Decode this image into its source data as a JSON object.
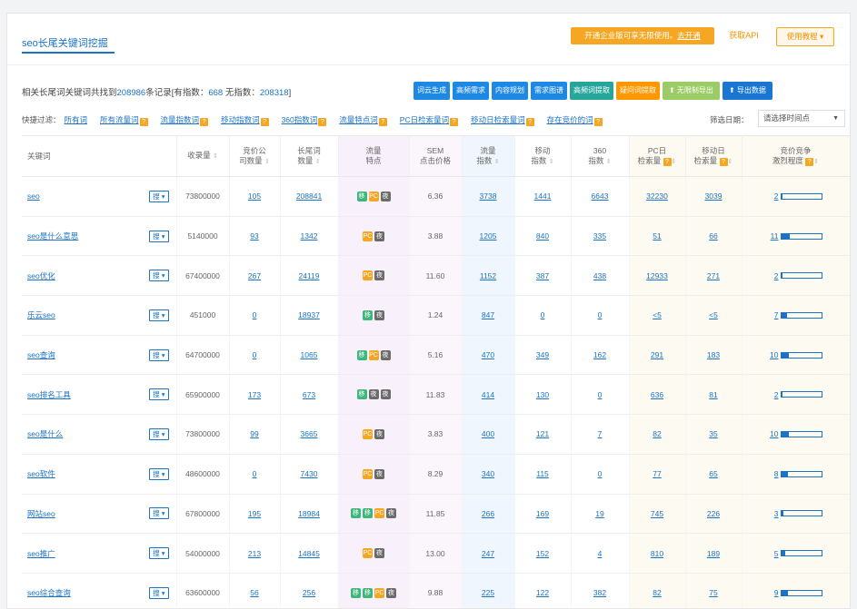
{
  "header": {
    "title": "seo长尾关键词挖掘",
    "promo_text": "开通企业版可享无限使用。",
    "promo_link": "去开通",
    "api_label": "获取API",
    "guide_label": "使用教程 ▾"
  },
  "summary": {
    "prefix": "相关长尾词关键词共找到",
    "total": "208986",
    "mid1": "条记录[有指数：",
    "with_index": "668",
    "mid2": " 无指数：",
    "without_index": "208318",
    "suffix": "]"
  },
  "actions": {
    "cloud": "词云生成",
    "high_demand": "高频需求",
    "content_plan": "内容规划",
    "demand_graph": "需求图谱",
    "high_freq": "高频词提取",
    "question": "疑问词提取",
    "unlimited_export": "⬆ 无限制导出",
    "export": "⬆ 导出数据"
  },
  "filters": {
    "label": "快捷过滤：",
    "items": [
      "所有词",
      "所有流量词",
      "流量指数词",
      "移动指数词",
      "360指数词",
      "流量特点词",
      "PC日检索量词",
      "移动日检索量词",
      "存在竞价的词"
    ]
  },
  "date": {
    "label": "筛选日期：",
    "placeholder": "请选择时间点",
    "caret": "▼"
  },
  "table": {
    "headers": {
      "keyword": "关键词",
      "records": "收录量",
      "bid_ads": "竞价公\n司数量",
      "longtail": "长尾词\n数量",
      "trait": "流量\n特点",
      "sem": "SEM\n点击价格",
      "flow": "流量\n指数",
      "mobile": "移动\n指数",
      "idx360": "360\n指数",
      "pcday": "PC日\n检索量",
      "mday": "移动日\n检索量",
      "comp": "竞价竞争\n激烈程度"
    },
    "search_tag": "搜 ▾",
    "rows": [
      {
        "kw": "seo",
        "records": "73800000",
        "bid": "105",
        "longtail": "208841",
        "badges": [
          "green",
          "orange",
          "gray"
        ],
        "sem": "6.36",
        "flow": "3738",
        "mobile": "1441",
        "i360": "6643",
        "pc": "32230",
        "md": "3039",
        "comp_num": "2",
        "comp": 0.04
      },
      {
        "kw": "seo是什么意思",
        "records": "5140000",
        "bid": "93",
        "longtail": "1342",
        "badges": [
          "orange",
          "gray"
        ],
        "sem": "3.88",
        "flow": "1205",
        "mobile": "840",
        "i360": "335",
        "pc": "51",
        "md": "66",
        "comp_num": "11",
        "comp": 0.22
      },
      {
        "kw": "seo优化",
        "records": "67400000",
        "bid": "267",
        "longtail": "24119",
        "badges": [
          "orange",
          "gray"
        ],
        "sem": "11.60",
        "flow": "1152",
        "mobile": "387",
        "i360": "438",
        "pc": "12933",
        "md": "271",
        "comp_num": "2",
        "comp": 0.04
      },
      {
        "kw": "乐云seo",
        "records": "451000",
        "bid": "0",
        "longtail": "18937",
        "badges": [
          "green",
          "gray"
        ],
        "sem": "1.24",
        "flow": "847",
        "mobile": "0",
        "i360": "0",
        "pc": "<5",
        "md": "<5",
        "comp_num": "7",
        "comp": 0.14
      },
      {
        "kw": "seo查询",
        "records": "64700000",
        "bid": "0",
        "longtail": "1065",
        "badges": [
          "green",
          "orange",
          "gray"
        ],
        "sem": "5.16",
        "flow": "470",
        "mobile": "349",
        "i360": "162",
        "pc": "291",
        "md": "183",
        "comp_num": "10",
        "comp": 0.2
      },
      {
        "kw": "seo排名工具",
        "records": "65900000",
        "bid": "173",
        "longtail": "673",
        "badges": [
          "green",
          "gray",
          "gray"
        ],
        "sem": "11.83",
        "flow": "414",
        "mobile": "130",
        "i360": "0",
        "pc": "636",
        "md": "81",
        "comp_num": "2",
        "comp": 0.04
      },
      {
        "kw": "seo是什么",
        "records": "73800000",
        "bid": "99",
        "longtail": "3665",
        "badges": [
          "orange",
          "gray"
        ],
        "sem": "3.83",
        "flow": "400",
        "mobile": "121",
        "i360": "7",
        "pc": "82",
        "md": "35",
        "comp_num": "10",
        "comp": 0.2
      },
      {
        "kw": "seo软件",
        "records": "48600000",
        "bid": "0",
        "longtail": "7430",
        "badges": [
          "orange",
          "gray"
        ],
        "sem": "8.29",
        "flow": "340",
        "mobile": "115",
        "i360": "0",
        "pc": "77",
        "md": "65",
        "comp_num": "8",
        "comp": 0.16
      },
      {
        "kw": "网站seo",
        "records": "67800000",
        "bid": "195",
        "longtail": "18984",
        "badges": [
          "green",
          "green",
          "orange",
          "gray"
        ],
        "sem": "11.85",
        "flow": "266",
        "mobile": "169",
        "i360": "19",
        "pc": "745",
        "md": "226",
        "comp_num": "3",
        "comp": 0.06
      },
      {
        "kw": "seo推广",
        "records": "54000000",
        "bid": "213",
        "longtail": "14845",
        "badges": [
          "orange",
          "gray"
        ],
        "sem": "13.00",
        "flow": "247",
        "mobile": "152",
        "i360": "4",
        "pc": "810",
        "md": "189",
        "comp_num": "5",
        "comp": 0.1
      },
      {
        "kw": "seo综合查询",
        "records": "63600000",
        "bid": "56",
        "longtail": "256",
        "badges": [
          "green",
          "green",
          "orange",
          "gray"
        ],
        "sem": "9.88",
        "flow": "225",
        "mobile": "122",
        "i360": "382",
        "pc": "82",
        "md": "75",
        "comp_num": "9",
        "comp": 0.18
      }
    ]
  },
  "icons": {
    "badge_green": "移-badge-icon",
    "badge_orange": "PC-badge-icon",
    "badge_gray": "夜-badge-icon",
    "question": "question-icon"
  },
  "colors": {
    "accent": "#1a73c7",
    "promo": "#f5a623",
    "badge_green": "#3db87a",
    "badge_orange": "#f5a623",
    "badge_gray": "#6b6b6b"
  }
}
